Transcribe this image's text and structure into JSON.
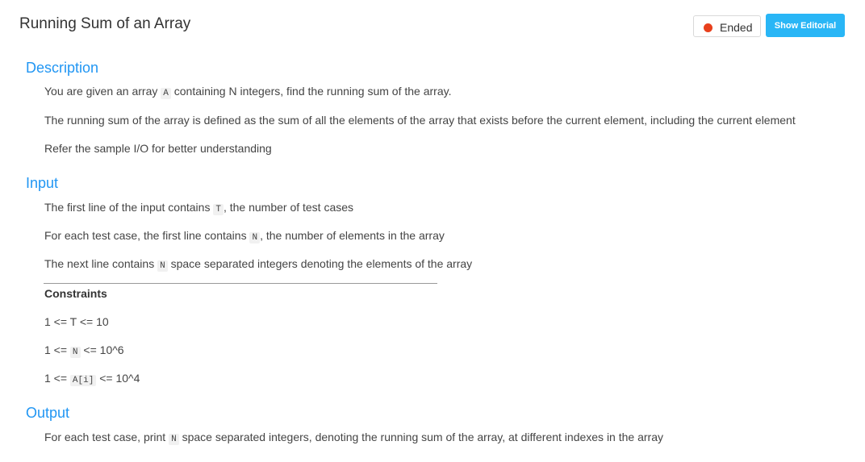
{
  "header": {
    "title": "Running Sum of an Array",
    "status_label": "Ended",
    "status_color": "#e8401c",
    "editorial_button_label": "Show Editorial",
    "editorial_button_color": "#29b6f6"
  },
  "description": {
    "heading": "Description",
    "p1": {
      "before": "You are given an array",
      "code": "A",
      "after": "containing N integers, find the running sum of the array."
    },
    "p2": "The running sum of the array is defined as the sum of all the elements of the array that exists before the current element, including the current element",
    "p3": "Refer the sample I/O for better understanding"
  },
  "input": {
    "heading": "Input",
    "p1": {
      "before": "The first line of the input contains",
      "code": "T",
      "after": ", the number of test cases"
    },
    "p2": {
      "before": "For each test case, the first line contains",
      "code": "N",
      "after": ", the number of elements in the array"
    },
    "p3": {
      "before": "The next line contains",
      "code": "N",
      "after": "space separated integers denoting the elements of the array"
    }
  },
  "constraints": {
    "heading": "Constraints",
    "c1": "1 <= T <= 10",
    "c2": {
      "before": "1 <=",
      "code": "N",
      "after": "<= 10^6"
    },
    "c3": {
      "before": "1 <=",
      "code": "A[i]",
      "after": "<= 10^4"
    }
  },
  "output": {
    "heading": "Output",
    "p1": {
      "before": "For each test case, print",
      "code": "N",
      "after": "space separated integers, denoting the running sum of the array, at different indexes in the array"
    }
  },
  "colors": {
    "heading": "#2196f3",
    "text": "#444444",
    "code_bg": "#f1f1f1"
  }
}
